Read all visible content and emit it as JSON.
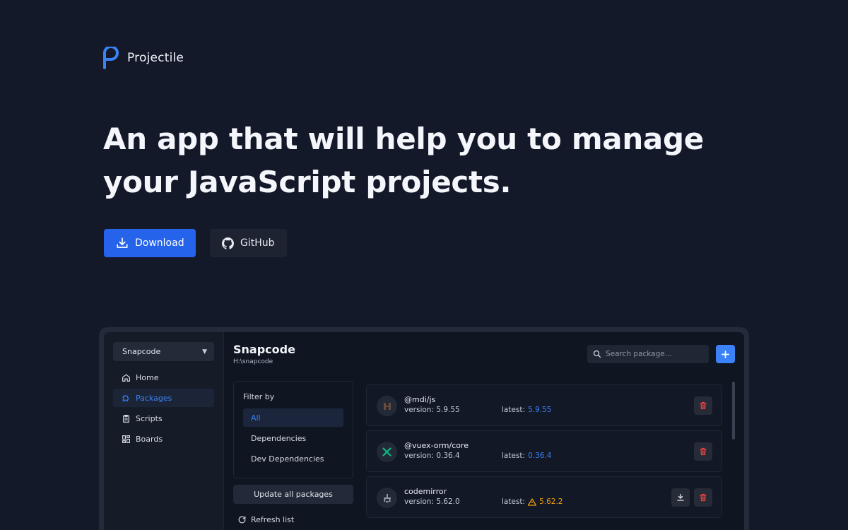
{
  "brand": {
    "name": "Projectile"
  },
  "hero": {
    "title_line1": "An app that will help you to manage",
    "title_line2": "your JavaScript projects."
  },
  "actions": {
    "download_label": "Download",
    "github_label": "GitHub"
  },
  "colors": {
    "accent": "#2563eb",
    "background": "#131929",
    "danger": "#ef4444",
    "warning": "#f59e0b"
  },
  "app": {
    "project_select": "Snapcode",
    "nav": [
      {
        "label": "Home",
        "icon": "home-icon"
      },
      {
        "label": "Packages",
        "icon": "puzzle-icon",
        "active": true
      },
      {
        "label": "Scripts",
        "icon": "clipboard-icon"
      },
      {
        "label": "Boards",
        "icon": "grid-icon"
      }
    ],
    "title": "Snapcode",
    "path": "H:\\snapcode",
    "search_placeholder": "Search package...",
    "filter": {
      "label": "Filter by",
      "options": [
        "All",
        "Dependencies",
        "Dev Dependencies"
      ],
      "selected": "All"
    },
    "update_all_label": "Update all packages",
    "refresh_label": "Refresh list",
    "packages": [
      {
        "name": "@mdi/js",
        "version": "version: 5.9.55",
        "latest_label": "latest:",
        "latest": "5.9.55",
        "outdated": false
      },
      {
        "name": "@vuex-orm/core",
        "version": "version: 0.36.4",
        "latest_label": "latest:",
        "latest": "0.36.4",
        "outdated": false
      },
      {
        "name": "codemirror",
        "version": "version: 5.62.0",
        "latest_label": "latest:",
        "latest": "5.62.2",
        "outdated": true
      }
    ]
  }
}
